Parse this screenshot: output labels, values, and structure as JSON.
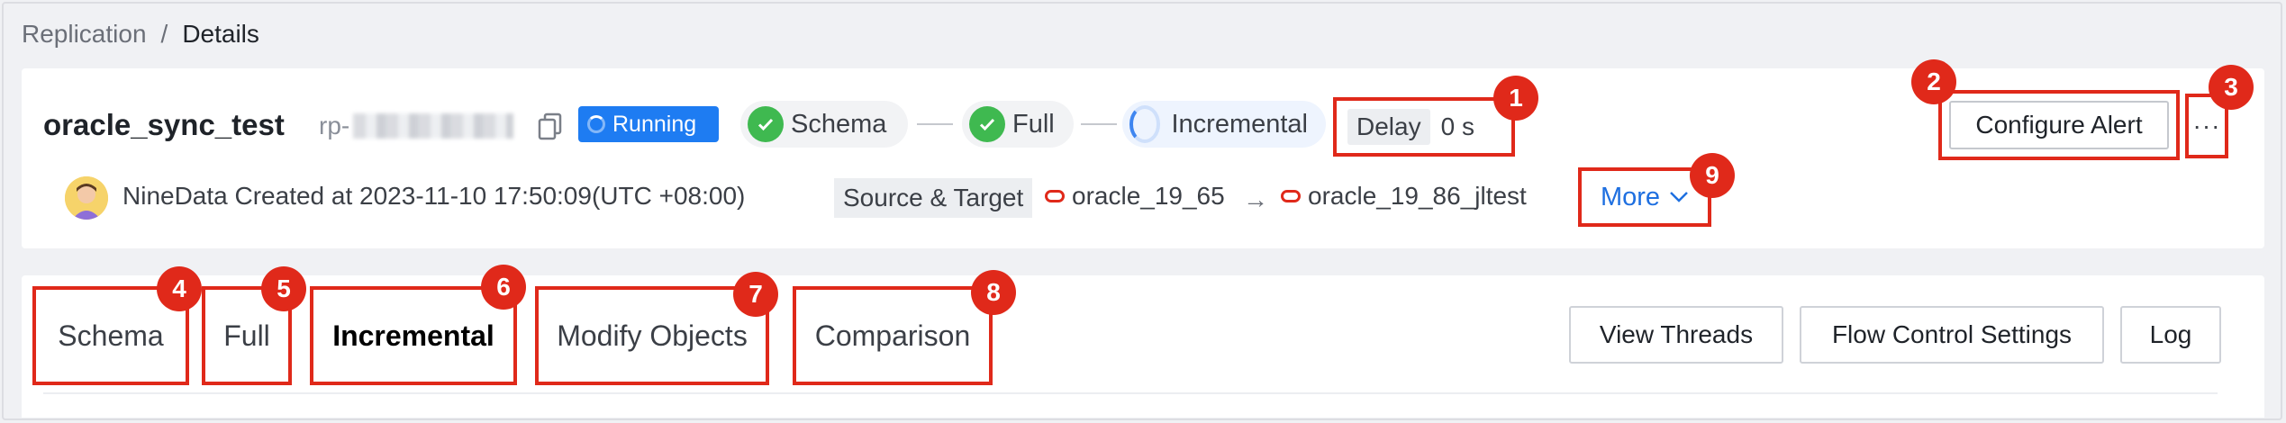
{
  "breadcrumb": {
    "parent": "Replication",
    "separator": "/",
    "current": "Details"
  },
  "task": {
    "name": "oracle_sync_test",
    "id_prefix": "rp-",
    "status": "Running",
    "stages": [
      {
        "label": "Schema",
        "state": "done"
      },
      {
        "label": "Full",
        "state": "done"
      },
      {
        "label": "Incremental",
        "state": "running"
      }
    ],
    "delay_label": "Delay",
    "delay_value": "0 s",
    "creator_text": "NineData Created at 2023-11-10 17:50:09(UTC +08:00)",
    "source_target_label": "Source & Target",
    "source": "oracle_19_65",
    "target": "oracle_19_86_jltest",
    "more_label": "More"
  },
  "actions": {
    "configure_alert": "Configure Alert",
    "more_dots": "···"
  },
  "tabs": [
    {
      "label": "Schema",
      "active": false
    },
    {
      "label": "Full",
      "active": false
    },
    {
      "label": "Incremental",
      "active": true
    },
    {
      "label": "Modify Objects",
      "active": false
    },
    {
      "label": "Comparison",
      "active": false
    }
  ],
  "tab_actions": {
    "view_threads": "View Threads",
    "flow_control": "Flow Control Settings",
    "log": "Log"
  },
  "annotations": [
    "1",
    "2",
    "3",
    "4",
    "5",
    "6",
    "7",
    "8",
    "9"
  ],
  "colors": {
    "accent": "#1e7cf2",
    "highlight": "#e0291a",
    "success": "#3fb950",
    "link": "#1e6fe0"
  }
}
